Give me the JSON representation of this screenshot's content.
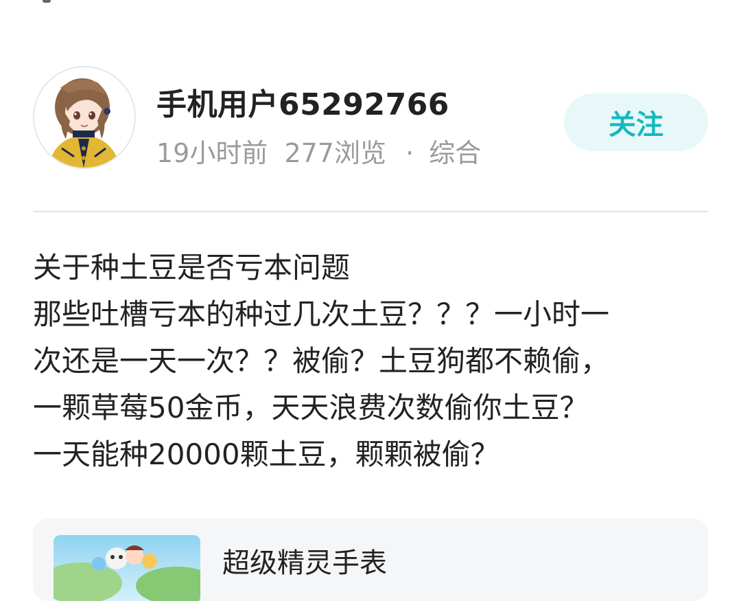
{
  "author": {
    "username": "手机用户65292766",
    "time": "19小时前",
    "views": "277浏览",
    "separator": "·",
    "category": "综合",
    "follow_label": "关注"
  },
  "post": {
    "lines": [
      "关于种土豆是否亏本问题",
      "那些吐槽亏本的种过几次土豆？？？一小时一",
      "次还是一天一次？？被偷？土豆狗都不赖偷，",
      "一颗草莓50金币，天天浪费次数偷你土豆？",
      "一天能种20000颗土豆，颗颗被偷？"
    ]
  },
  "game_card": {
    "title": "超级精灵手表"
  },
  "colors": {
    "accent": "#14b9c0",
    "follow_bg": "#e8f8f8",
    "meta_text": "#9a9a9a",
    "card_bg": "#f5f6f7"
  }
}
